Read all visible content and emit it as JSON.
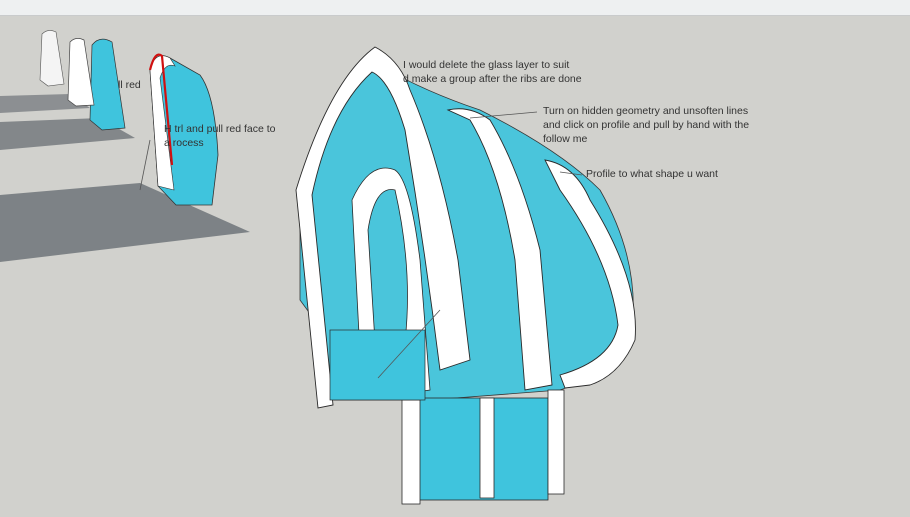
{
  "window": {
    "title": ""
  },
  "colors": {
    "background": "#d1d1cd",
    "glass": "#3fc4dd",
    "rib": "#ffffff",
    "highlight_edge": "#d01010",
    "ground_shadow": "#6f7479"
  },
  "annotations": [
    {
      "id": "delete-glass",
      "lines": [
        "I would delete the glass layer to suit",
        "d make a group after the ribs are done"
      ]
    },
    {
      "id": "hidden-geometry",
      "lines": [
        "Turn on hidden geometry and unsoften lines",
        "and click on profile and pull by hand with the",
        "follow me"
      ]
    },
    {
      "id": "profile-shape",
      "lines": [
        "Profile to what shape u want"
      ]
    },
    {
      "id": "ctrl-pull",
      "lines": [
        "H        trl and pull red face to",
        "a          rocess"
      ]
    },
    {
      "id": "pull-red",
      "lines": [
        "ll red"
      ]
    }
  ]
}
